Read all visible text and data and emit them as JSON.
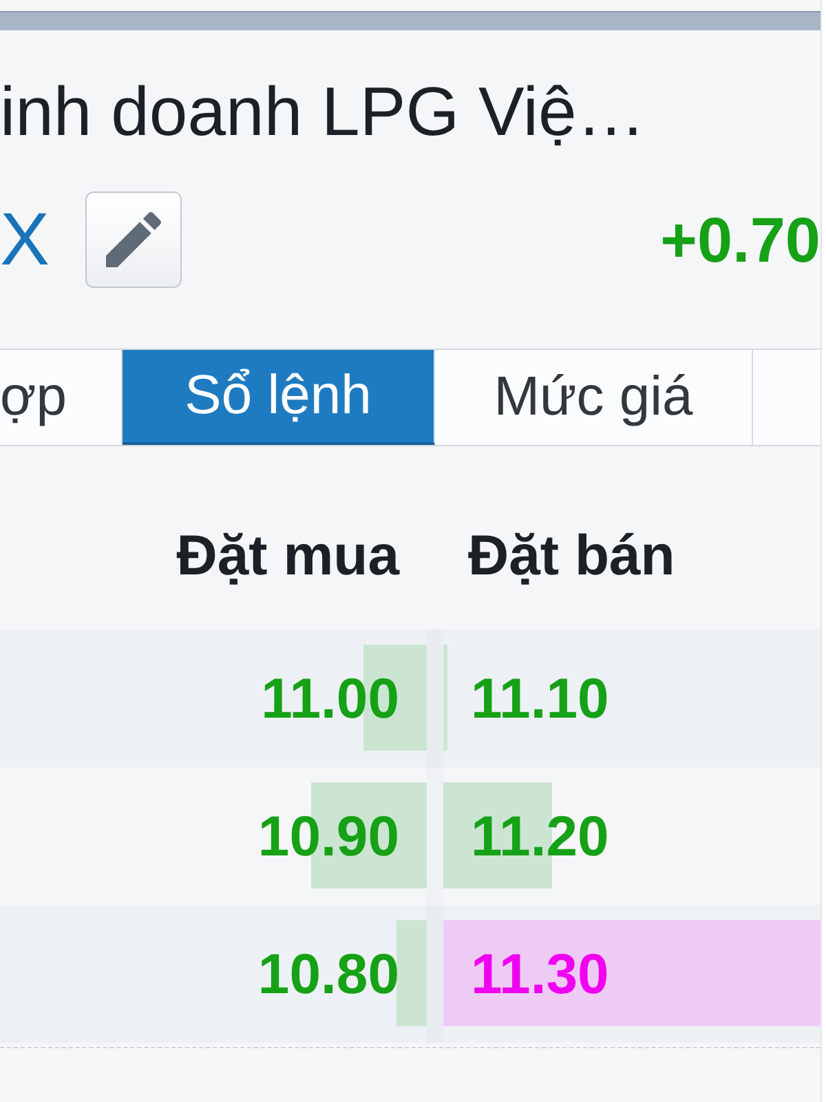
{
  "stock": {
    "name": "inh doanh LPG Việ…",
    "exchange": "X",
    "change": "+0.70"
  },
  "tabs": [
    {
      "label": "ợp",
      "selected": false
    },
    {
      "label": "Sổ lệnh",
      "selected": true
    },
    {
      "label": "Mức giá",
      "selected": false
    }
  ],
  "order_book": {
    "columns": [
      "Đặt mua",
      "Đặt bán"
    ],
    "rows": [
      {
        "bid": {
          "price": "11.00",
          "color": "#16a116",
          "level": 0.15
        },
        "ask": {
          "price": "11.10",
          "color": "#16a116",
          "level": 0.012
        }
      },
      {
        "bid": {
          "price": "10.90",
          "color": "#16a116",
          "level": 0.27
        },
        "ask": {
          "price": "11.20",
          "color": "#16a116",
          "level": 0.29
        }
      },
      {
        "bid": {
          "price": "10.80",
          "color": "#16a116",
          "level": 0.07
        },
        "ask": {
          "price": "11.30",
          "color": "#f000f0",
          "level": 1
        }
      }
    ]
  }
}
